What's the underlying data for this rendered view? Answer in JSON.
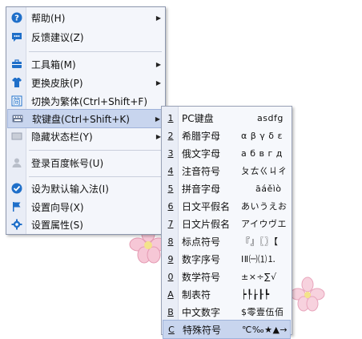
{
  "main_menu": {
    "items": [
      {
        "label": "帮助(H)",
        "icon": "help-icon",
        "arrow": true
      },
      {
        "label": "反馈建议(Z)",
        "icon": "feedback-icon",
        "arrow": false
      },
      {
        "label": "工具箱(M)",
        "icon": "toolbox-icon",
        "arrow": true
      },
      {
        "label": "更换皮肤(P)",
        "icon": "shirt-icon",
        "arrow": true
      },
      {
        "label": "切换为繁体(Ctrl+Shift+F)",
        "icon": "traditional-icon",
        "arrow": false
      },
      {
        "label": "软键盘(Ctrl+Shift+K)",
        "icon": "keyboard-icon",
        "arrow": true
      },
      {
        "label": "隐藏状态栏(Y)",
        "icon": "hide-icon",
        "arrow": true
      },
      {
        "label": "登录百度帐号(U)",
        "icon": "user-icon",
        "arrow": false
      },
      {
        "label": "设为默认输入法(I)",
        "icon": "check-icon",
        "arrow": false
      },
      {
        "label": "设置向导(X)",
        "icon": "flag-icon",
        "arrow": false
      },
      {
        "label": "设置属性(S)",
        "icon": "gear-icon",
        "arrow": false
      }
    ]
  },
  "soft_keyboard_menu": {
    "items": [
      {
        "key": "1",
        "name": "PC键盘",
        "preview": "asdfg"
      },
      {
        "key": "2",
        "name": "希腊字母",
        "preview": "α β γ δ ε"
      },
      {
        "key": "3",
        "name": "俄文字母",
        "preview": "а б в г д"
      },
      {
        "key": "4",
        "name": "注音符号",
        "preview": "ㄆㄊㄍㄐㄔ"
      },
      {
        "key": "5",
        "name": "拼音字母",
        "preview": "āáěìò"
      },
      {
        "key": "6",
        "name": "日文平假名",
        "preview": "あいうえお"
      },
      {
        "key": "7",
        "name": "日文片假名",
        "preview": "アイウヴエ"
      },
      {
        "key": "8",
        "name": "标点符号",
        "preview": "『』〖〗【"
      },
      {
        "key": "9",
        "name": "数字序号",
        "preview": "ⅠⅡ㈠⑴⒈"
      },
      {
        "key": "0",
        "name": "数学符号",
        "preview": "±×÷∑√"
      },
      {
        "key": "A",
        "name": "制表符",
        "preview": "┝┞┟┠┡"
      },
      {
        "key": "B",
        "name": "中文数字",
        "preview": "$零壹伍佰"
      },
      {
        "key": "C",
        "name": "特殊符号",
        "preview": "℃‰★▲→"
      }
    ]
  },
  "colors": {
    "menu_bg": "#f4f6fb",
    "highlight": "#c8d5ee",
    "icon_blue": "#1f6fc9"
  }
}
